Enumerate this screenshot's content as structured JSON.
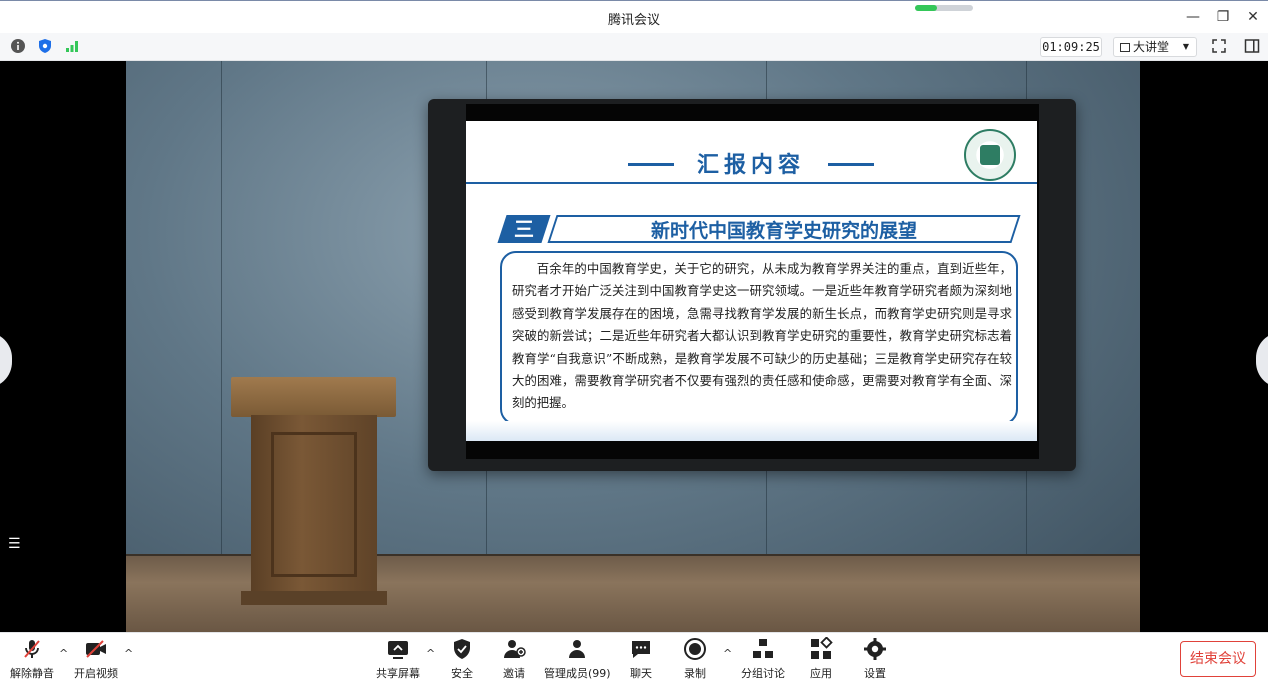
{
  "window": {
    "title": "腾讯会议"
  },
  "infobar": {
    "timer": "01:09:25",
    "layout_label": "大讲堂"
  },
  "slide": {
    "heading": "汇报内容",
    "section_number": "三",
    "subtitle": "新时代中国教育学史研究的展望",
    "paragraph": "百余年的中国教育学史，关于它的研究，从未成为教育学界关注的重点，直到近些年，研究者才开始广泛关注到中国教育学史这一研究领域。一是近些年教育学研究者颇为深刻地感受到教育学发展存在的困境，急需寻找教育学发展的新生长点，而教育学史研究则是寻求突破的新尝试；二是近些年研究者大都认识到教育学史研究的重要性，教育学史研究标志着教育学“自我意识”不断成熟，是教育学发展不可缺少的历史基础；三是教育学史研究存在较大的困难，需要教育学研究者不仅要有强烈的责任感和使命感，更需要对教育学有全面、深刻的把握。"
  },
  "toolbar": {
    "unmute": "解除静音",
    "start_video": "开启视频",
    "share_screen": "共享屏幕",
    "security": "安全",
    "invite": "邀请",
    "manage_members": "管理成员(99)",
    "chat": "聊天",
    "record": "录制",
    "breakout": "分组讨论",
    "apps": "应用",
    "settings": "设置",
    "end_meeting": "结束会议"
  },
  "colors": {
    "accent": "#1d5fa3",
    "end_red": "#e0423a",
    "network_green": "#34c759"
  }
}
